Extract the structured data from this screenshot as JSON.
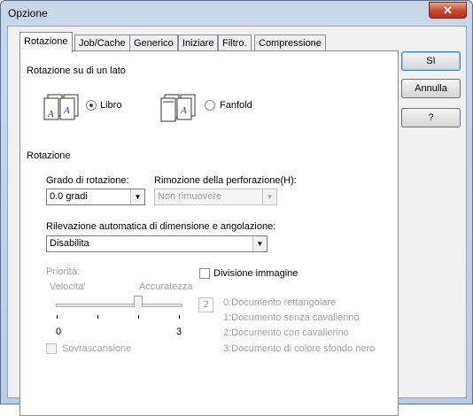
{
  "window": {
    "title": "Opzione",
    "close_glyph": "✕"
  },
  "tabs": [
    {
      "label": "Rotazione",
      "active": true
    },
    {
      "label": "Job/Cache"
    },
    {
      "label": "Generico"
    },
    {
      "label": "Iniziare"
    },
    {
      "label": "Filtro."
    },
    {
      "label": "Compressione"
    }
  ],
  "buttons": {
    "ok": "Sì",
    "cancel": "Annulla",
    "help": "?"
  },
  "side": {
    "group_title": "Rotazione su di un lato",
    "options": [
      {
        "label": "Libro",
        "selected": true,
        "icon": "book-pages-icon"
      },
      {
        "label": "Fanfold",
        "selected": false,
        "icon": "fanfold-pages-icon"
      }
    ]
  },
  "rotation": {
    "group_title": "Rotazione",
    "degree_label": "Grado di rotazione:",
    "degree_value": "0.0 gradi",
    "punch_label": "Rimozione della perforazione(H):",
    "punch_value": "Non rimuovere",
    "auto_label": "Rilevazione automatica di dimensione e angolazione:",
    "auto_value": "Disabilita"
  },
  "priority": {
    "label": "Priorità:",
    "left": "Velocita'",
    "right": "Accuratezza",
    "min": "0",
    "max": "3",
    "value": "2",
    "level": 2
  },
  "split_image_label": "Divisione immagine",
  "overscan_label": "Sovrascansione",
  "doc_types": [
    "0:Documento rettangolare",
    "1:Documento senza cavalierino",
    "2:Documento con cavalierino",
    "3:Documento di colore sfondo nero"
  ]
}
